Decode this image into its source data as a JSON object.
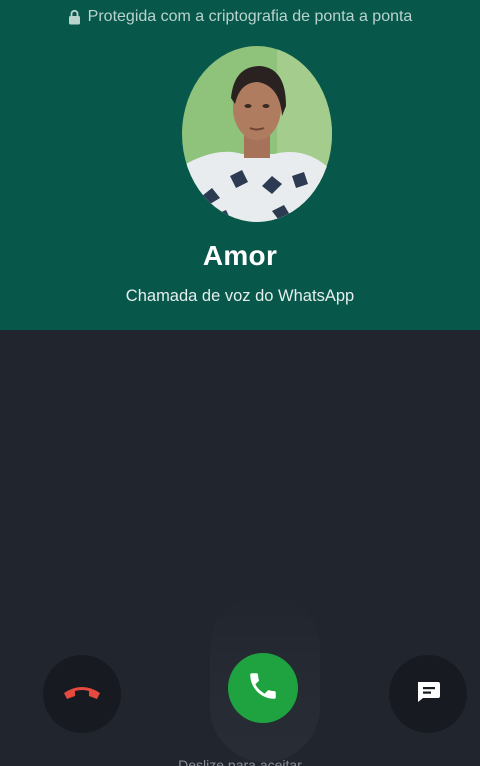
{
  "header": {
    "encryption_text": "Protegida com a criptografia de ponta a ponta",
    "lock_icon": "lock-icon"
  },
  "caller": {
    "name": "Amor",
    "call_type": "Chamada de voz do WhatsApp"
  },
  "actions": {
    "decline_icon": "phone-hangup-icon",
    "accept_icon": "phone-icon",
    "message_icon": "message-icon",
    "swipe_hint": "Deslize para aceitar"
  },
  "colors": {
    "top_panel": "#07574b",
    "bottom_panel": "#20252e",
    "accept": "#1fa340",
    "decline_icon": "#e5493f"
  }
}
